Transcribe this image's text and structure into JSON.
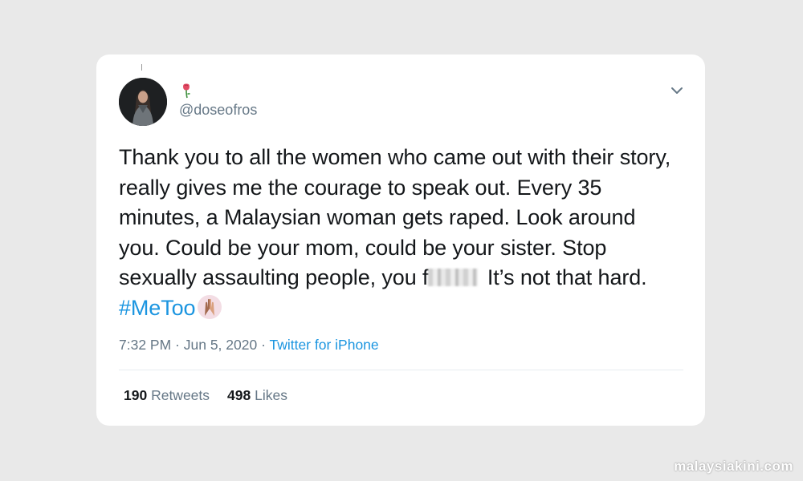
{
  "tweet": {
    "author": {
      "avatar": "profile-photo",
      "name_emoji": "rose-emoji",
      "handle": "@doseofros"
    },
    "menu_icon": "chevron-down-icon",
    "text": {
      "part1": "Thank you to all the women who came out with their story, really gives me the courage to speak out. Every 35 minutes, a Malaysian woman gets raped. Look around you. Could be your mom, could be your sister. Stop sexually assaulting people, you f",
      "censored": "blurred-word",
      "part2": " It’s not that hard. ",
      "hashtag": "#MeToo",
      "emoji": "raised-hands-emoji"
    },
    "meta": {
      "time": "7:32 PM",
      "separator1": " · ",
      "date": "Jun 5, 2020",
      "separator2": " · ",
      "source": "Twitter for iPhone"
    },
    "stats": {
      "retweets_count": "190",
      "retweets_label": "Retweets",
      "likes_count": "498",
      "likes_label": "Likes"
    }
  },
  "watermark": "malaysiakini.com",
  "colors": {
    "background": "#e9e9e9",
    "card": "#ffffff",
    "text": "#14171a",
    "muted": "#657786",
    "link": "#1b95e0"
  }
}
